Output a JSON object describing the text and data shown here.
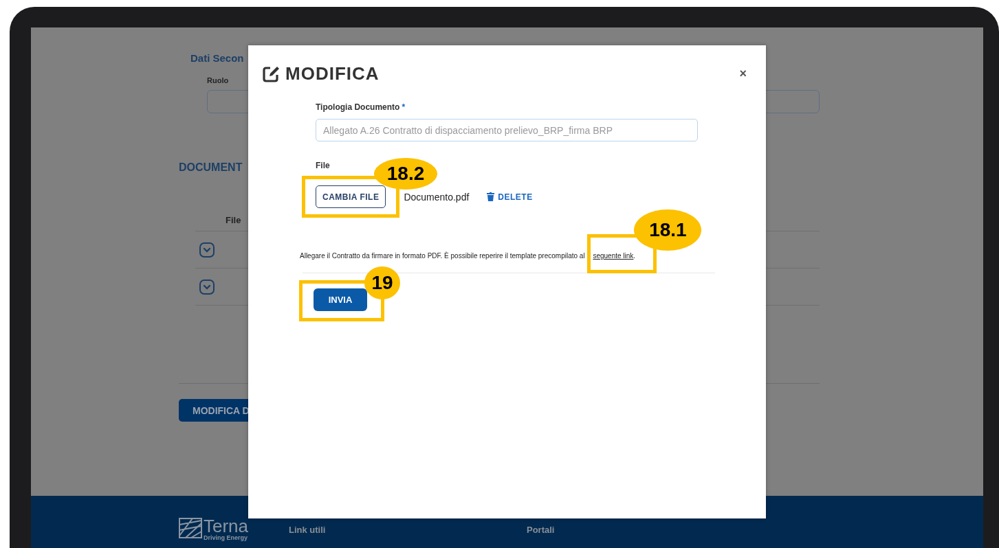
{
  "background_page": {
    "section_title": "Dati Secon",
    "role_label": "Ruolo",
    "documents_title": "DOCUMENT",
    "table": {
      "columns": [
        "File"
      ],
      "rows": [
        {
          "expanded": false
        },
        {
          "expanded": false
        }
      ]
    },
    "primary_button": "MODIFICA D"
  },
  "footer": {
    "logo": {
      "name": "Terna",
      "tagline": "Driving Energy"
    },
    "columns": [
      "Link utili",
      "Portali"
    ]
  },
  "modal": {
    "title": "MODIFICA",
    "close": "×",
    "document_type": {
      "label": "Tipologia Documento",
      "required_mark": "*",
      "value": "Allegato A.26 Contratto di dispacciamento prelievo_BRP_firma BRP",
      "disabled": true
    },
    "file": {
      "label": "File",
      "change_button": {
        "label": "CAMBIA FILE",
        "callout": "18.2"
      },
      "file_name": "Documento.pdf",
      "delete": "DELETE"
    },
    "help_text": {
      "before": "Allegare il Contratto da firmare in formato PDF. È possibile reperire il template precompilato al ",
      "link": {
        "label": "seguente link",
        "callout": "18.1"
      },
      "after": "."
    },
    "submit": {
      "label": "INVIA",
      "callout": "19"
    }
  }
}
